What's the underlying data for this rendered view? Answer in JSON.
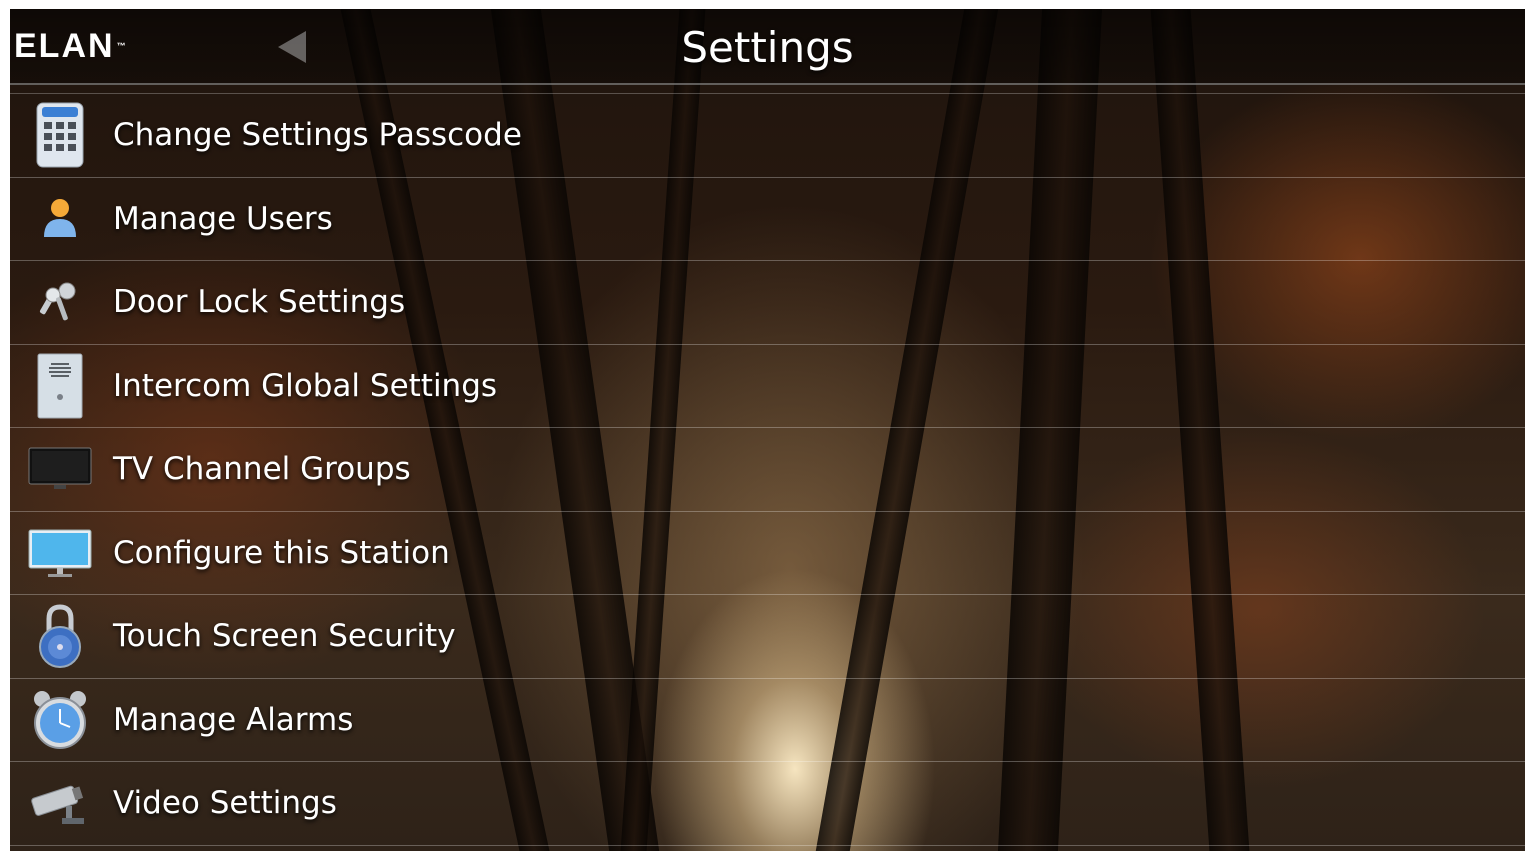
{
  "header": {
    "logo_text": "ELAN",
    "logo_tm": "™",
    "title": "Settings",
    "back_icon": "back-arrow-icon"
  },
  "menu": {
    "items": [
      {
        "label": "Change Settings Passcode",
        "icon": "keypad-icon"
      },
      {
        "label": "Manage Users",
        "icon": "user-icon"
      },
      {
        "label": "Door Lock Settings",
        "icon": "keys-icon"
      },
      {
        "label": "Intercom Global Settings",
        "icon": "intercom-icon"
      },
      {
        "label": "TV Channel Groups",
        "icon": "tv-icon"
      },
      {
        "label": "Configure this Station",
        "icon": "monitor-icon"
      },
      {
        "label": "Touch Screen Security",
        "icon": "padlock-icon"
      },
      {
        "label": "Manage Alarms",
        "icon": "alarm-clock-icon"
      },
      {
        "label": "Video Settings",
        "icon": "security-camera-icon"
      }
    ]
  },
  "colors": {
    "accent": "#f0a020",
    "text": "#ffffff"
  }
}
